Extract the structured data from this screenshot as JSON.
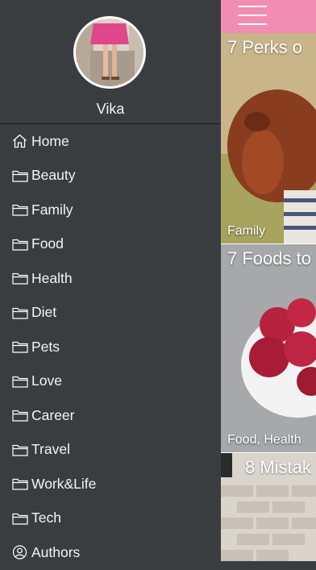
{
  "profile": {
    "name": "Vika"
  },
  "menu": {
    "items": [
      {
        "label": "Home",
        "icon": "home-icon"
      },
      {
        "label": "Beauty",
        "icon": "folder-icon"
      },
      {
        "label": "Family",
        "icon": "folder-icon"
      },
      {
        "label": "Food",
        "icon": "folder-icon"
      },
      {
        "label": "Health",
        "icon": "folder-icon"
      },
      {
        "label": "Diet",
        "icon": "folder-icon"
      },
      {
        "label": "Pets",
        "icon": "folder-icon"
      },
      {
        "label": "Love",
        "icon": "folder-icon"
      },
      {
        "label": "Career",
        "icon": "folder-icon"
      },
      {
        "label": "Travel",
        "icon": "folder-icon"
      },
      {
        "label": "Work&Life",
        "icon": "folder-icon"
      },
      {
        "label": "Tech",
        "icon": "folder-icon"
      },
      {
        "label": "Authors",
        "icon": "user-circle-icon"
      }
    ]
  },
  "feed": {
    "cards": [
      {
        "title": "7 Perks o",
        "tag": "Family"
      },
      {
        "title": "7 Foods to",
        "tag": "Food, Health"
      },
      {
        "title": "8 Mistak",
        "tag": ""
      }
    ]
  },
  "colors": {
    "drawer_bg": "#3a3d40",
    "accent_pink": "#f08db0",
    "text": "#ffffff"
  }
}
